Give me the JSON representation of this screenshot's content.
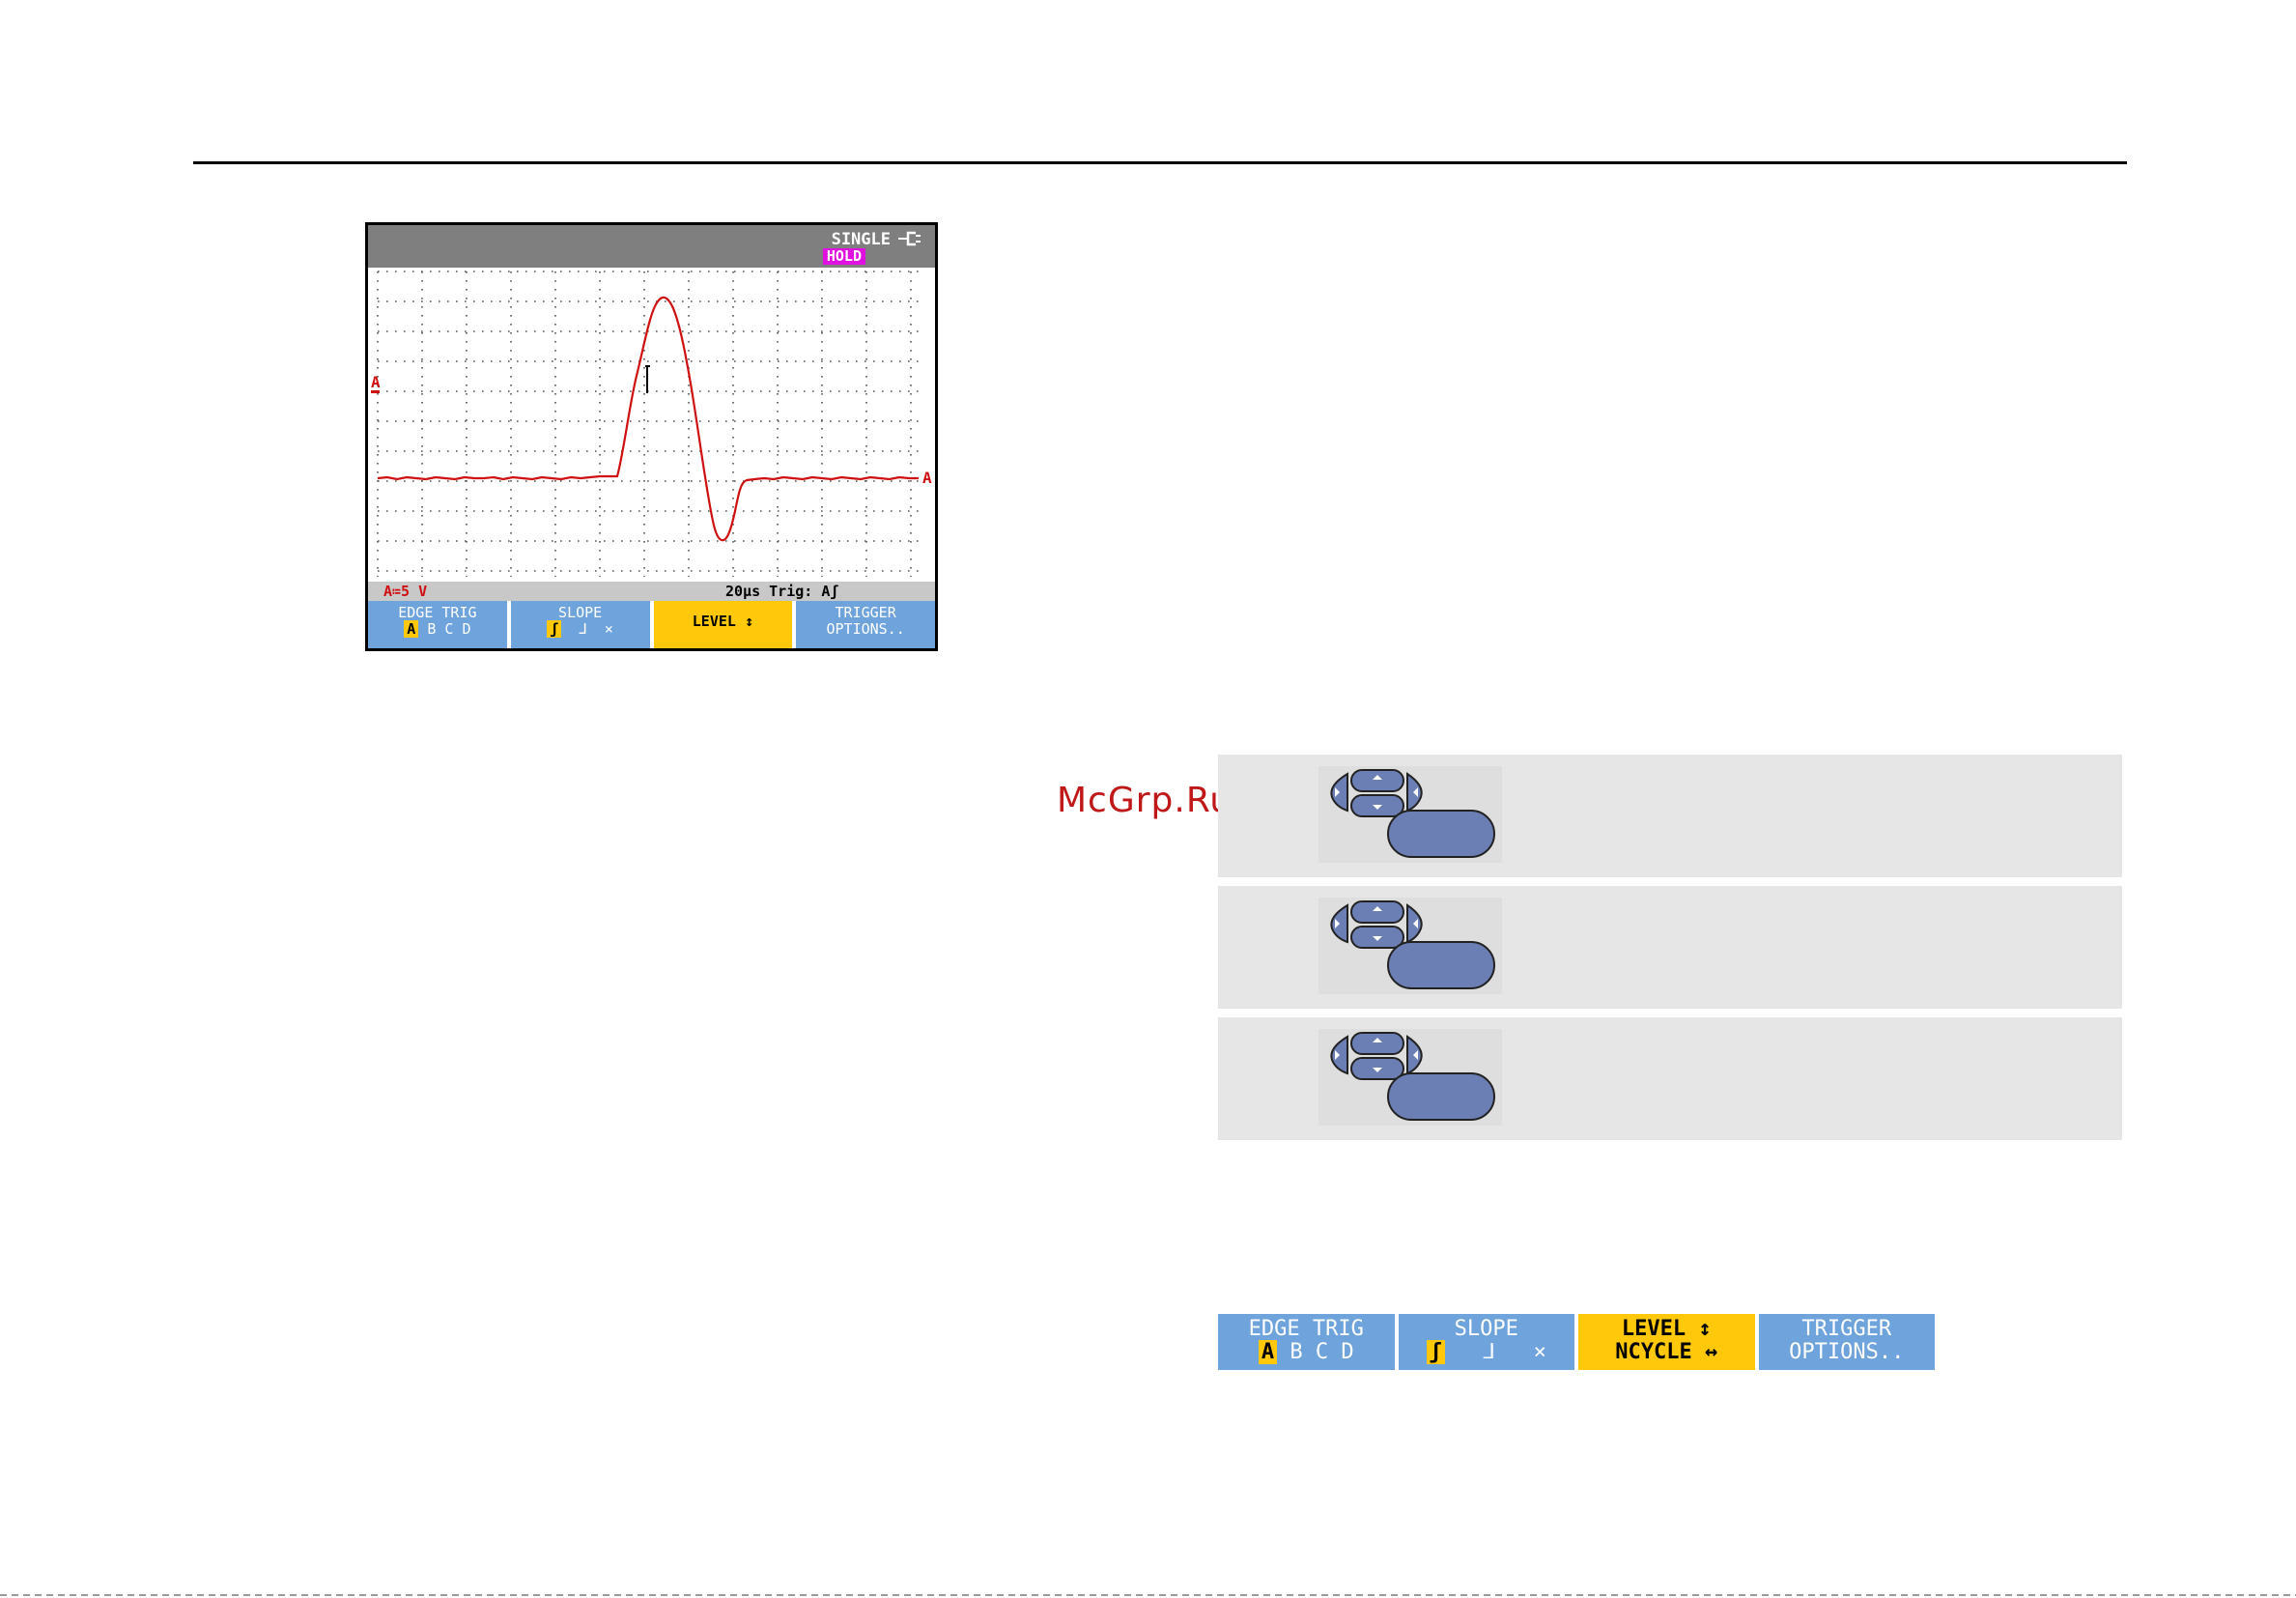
{
  "scope": {
    "mode": "SINGLE",
    "hold_badge": "HOLD",
    "channel_marker": "A",
    "scale_left": "A≔5 V",
    "scale_right": "20µs Trig: Aʃ",
    "softkeys": [
      {
        "label": "EDGE TRIG",
        "sub": [
          "A",
          "B",
          "C",
          "D"
        ],
        "selected": "A"
      },
      {
        "label": "SLOPE",
        "sub": [
          "ʃ",
          "⅃",
          "⨯"
        ],
        "selected": "ʃ"
      },
      {
        "label": "LEVEL ↕",
        "active": true
      },
      {
        "label": "TRIGGER",
        "sub_text": "OPTIONS.."
      }
    ],
    "colors": {
      "trace": "#d01010",
      "header": "#7f7f7f",
      "softkey": "#6fa3db",
      "active": "#ffc80a",
      "hold": "#e010e0"
    }
  },
  "watermark": "McGrp.Ru",
  "steps": [
    {
      "icon": "arrow-keypad-icon"
    },
    {
      "icon": "arrow-keypad-icon"
    },
    {
      "icon": "arrow-keypad-icon"
    }
  ],
  "bottom_bar": {
    "keys": [
      {
        "label": "EDGE TRIG",
        "sub": [
          "A",
          "B",
          "C",
          "D"
        ],
        "selected": "A"
      },
      {
        "label": "SLOPE",
        "sub": [
          "ʃ",
          "⅃",
          "⨯"
        ],
        "selected": "ʃ"
      },
      {
        "label": "LEVEL ↕",
        "sub_text": "NCYCLE ↔",
        "active": true
      },
      {
        "label": "TRIGGER",
        "sub_text": "OPTIONS.."
      }
    ]
  }
}
